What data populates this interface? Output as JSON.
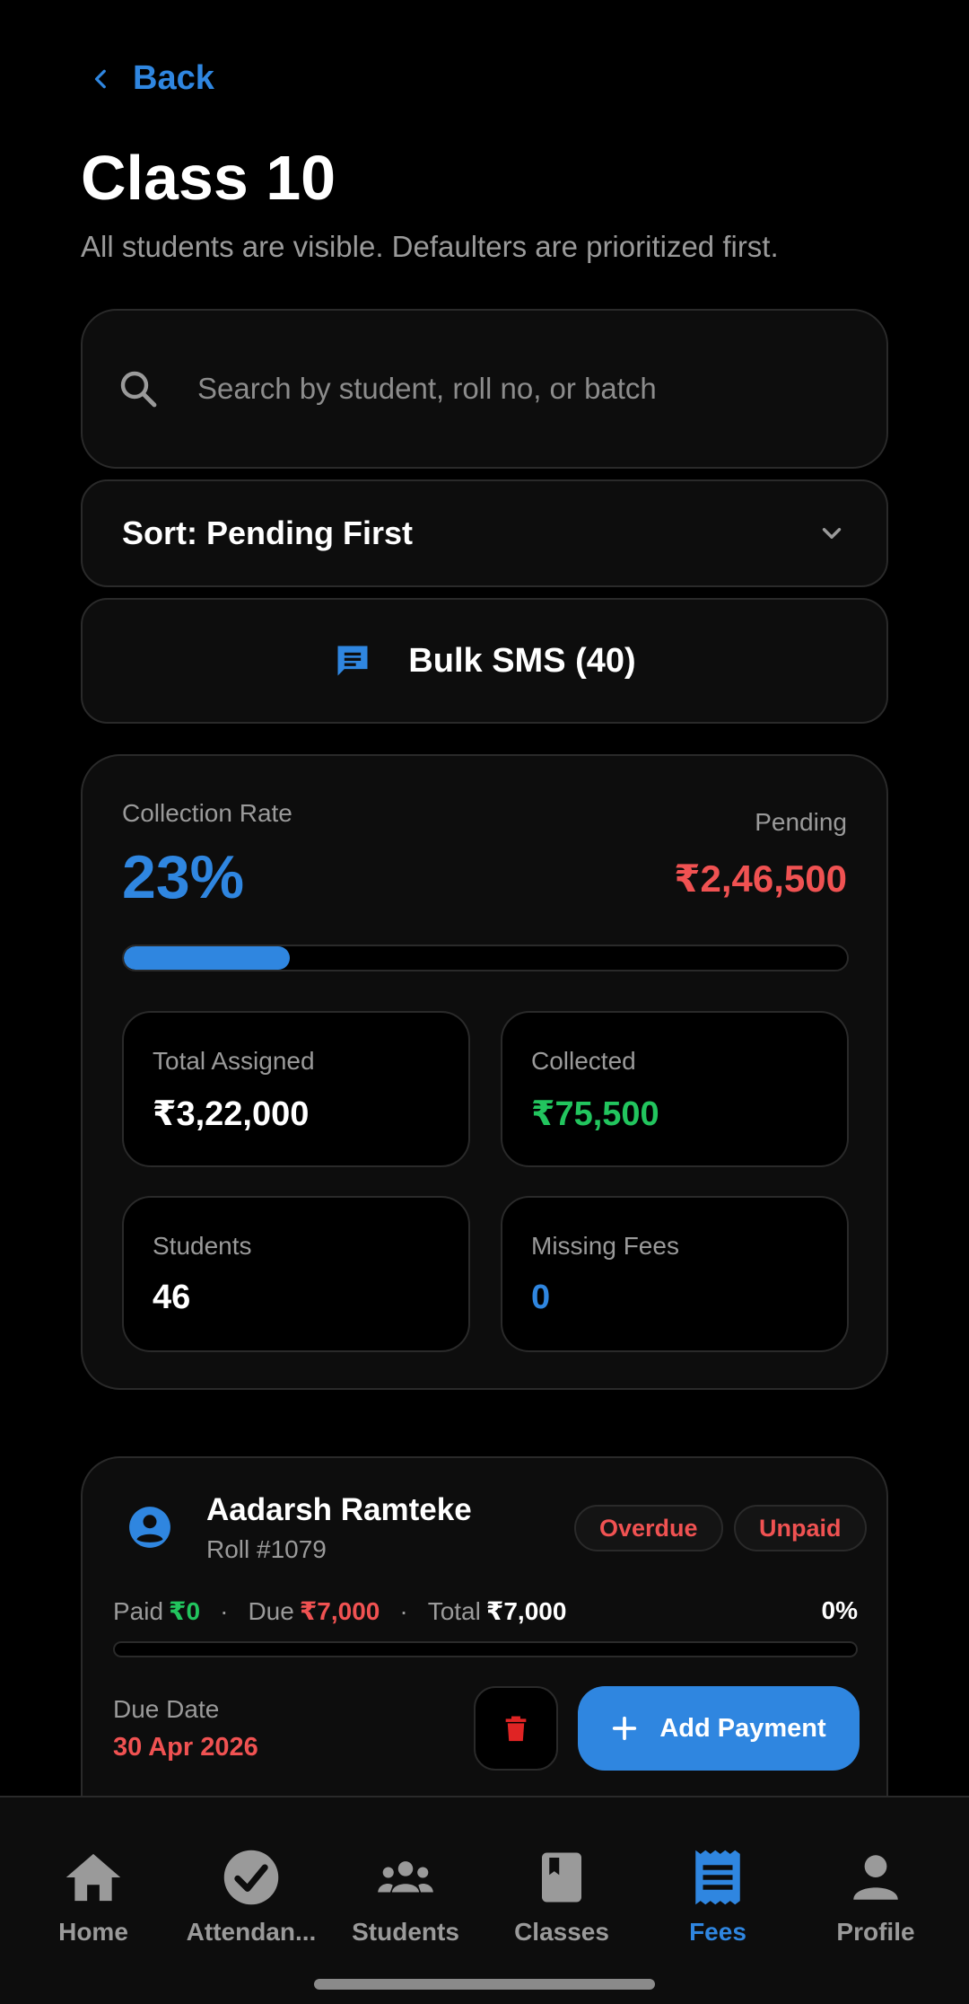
{
  "header": {
    "back_label": "Back",
    "title": "Class 10",
    "subtitle": "All students are visible. Defaulters are prioritized first."
  },
  "search": {
    "placeholder": "Search by student, roll no, or batch",
    "value": ""
  },
  "sort": {
    "label": "Sort: Pending First"
  },
  "bulk_sms": {
    "label": "Bulk SMS (40)"
  },
  "summary": {
    "collection_rate_label": "Collection Rate",
    "collection_rate_value": "23%",
    "collection_rate_fraction": 0.23,
    "pending_label": "Pending",
    "pending_value": "₹2,46,500",
    "tiles": [
      {
        "label": "Total Assigned",
        "value": "₹3,22,000"
      },
      {
        "label": "Collected",
        "value": "₹75,500"
      },
      {
        "label": "Students",
        "value": "46"
      },
      {
        "label": "Missing Fees",
        "value": "0"
      }
    ]
  },
  "student": {
    "name": "Aadarsh Ramteke",
    "roll": "Roll #1079",
    "badges": [
      "Overdue",
      "Unpaid"
    ],
    "paid_label": "Paid",
    "paid_value": "₹0",
    "due_label": "Due",
    "due_value": "₹7,000",
    "total_label": "Total",
    "total_value": "₹7,000",
    "separator": "·",
    "percent": "0%",
    "due_date_label": "Due Date",
    "due_date_value": "30 Apr 2026",
    "add_payment_label": "Add Payment"
  },
  "nav": {
    "items": [
      {
        "label": "Home",
        "icon": "home-icon"
      },
      {
        "label": "Attendan...",
        "icon": "check-circle-icon"
      },
      {
        "label": "Students",
        "icon": "group-icon"
      },
      {
        "label": "Classes",
        "icon": "book-icon"
      },
      {
        "label": "Fees",
        "icon": "receipt-icon",
        "active": true
      },
      {
        "label": "Profile",
        "icon": "person-icon"
      }
    ]
  },
  "colors": {
    "accent": "#2f86e0",
    "danger": "#f05252",
    "success": "#22c55e",
    "background": "#000000",
    "card": "#0d0d0d"
  }
}
